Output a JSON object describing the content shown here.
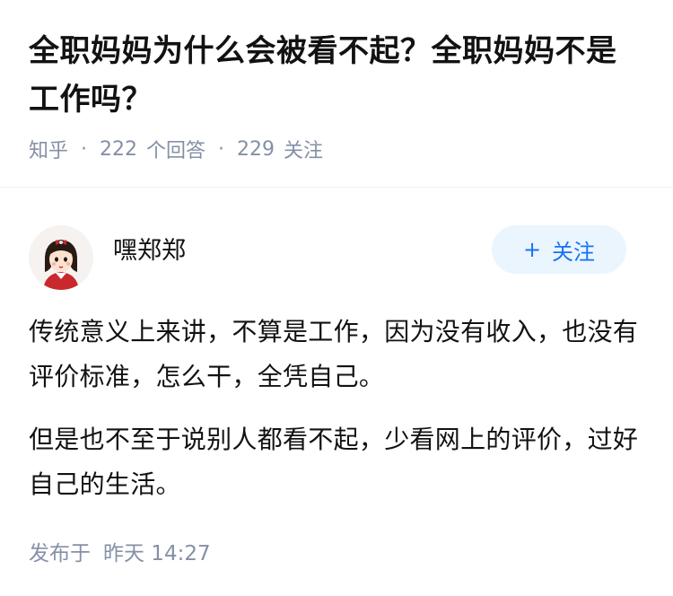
{
  "question": {
    "title": "全职妈妈为什么会被看不起？全职妈妈不是工作吗？",
    "source": "知乎",
    "answer_count": "222",
    "answer_label": "个回答",
    "follower_count": "229",
    "follower_label": "关注"
  },
  "author": {
    "name": "嘿郑郑",
    "avatar_icon": "cartoon-girl-avatar",
    "follow_label": "关注",
    "follow_icon": "plus"
  },
  "answer": {
    "paragraphs": [
      "传统意义上来讲，不算是工作，因为没有收入，也没有评价标准，怎么干，全凭自己。",
      "但是也不至于说别人都看不起，少看网上的评价，过好自己的生活。"
    ],
    "publish_label": "发布于",
    "publish_time": "昨天 14:27"
  },
  "colors": {
    "title": "#121212",
    "meta": "#8590a6",
    "accent": "#1772f6",
    "follow_bg": "#ebf5fd"
  }
}
